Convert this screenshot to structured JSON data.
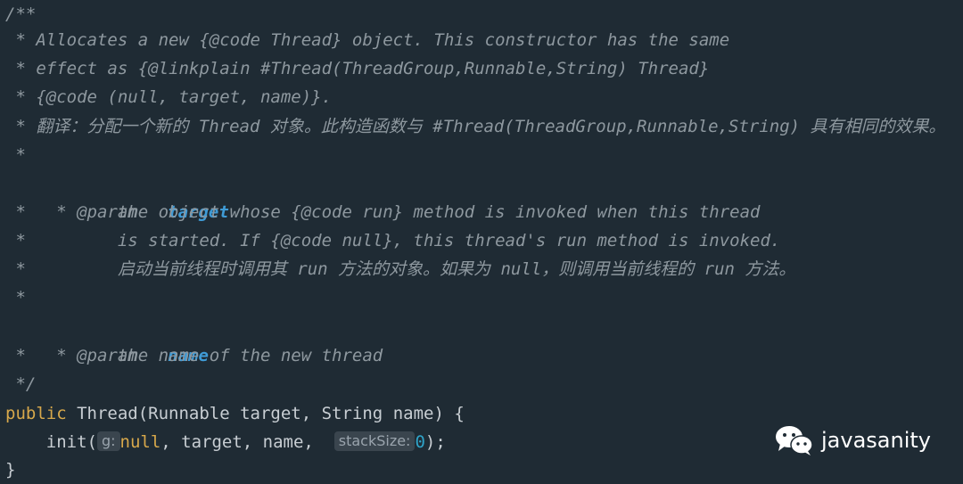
{
  "code_lines": [
    "/**",
    " * Allocates a new {@code Thread} object. This constructor has the same",
    " * effect as {@linkplain #Thread(ThreadGroup,Runnable,String) Thread}",
    " * {@code (null, target, name)}.",
    " * 翻译：分配一个新的 Thread 对象。此构造函数与 #Thread(ThreadGroup,Runnable,String) 具有相同的效果。",
    " *",
    " * @param ",
    " *         the object whose {@code run} method is invoked when this thread",
    " *         is started. If {@code null}, this thread's run method is invoked.",
    " *         启动当前线程时调用其 run 方法的对象。如果为 null，则调用当前线程的 run 方法。",
    " *",
    " * @param ",
    " *         the name of the new thread",
    " */"
  ],
  "params": {
    "target": "target",
    "name": "name"
  },
  "code": {
    "sig_kw": "public",
    "sig_rest": " Thread(Runnable target, String name) {",
    "call_start": "    init(",
    "hint_g": "g:",
    "null_val": "null",
    "call_mid": ", target, name,  ",
    "hint_stack": "stackSize:",
    "zero_val": "0",
    "call_end": ");",
    "close": "}"
  },
  "watermark": {
    "text": "javasanity",
    "icon": "wechat-icon"
  },
  "colors": {
    "background": "#1f2b34",
    "comment": "#8e989f",
    "param": "#3f9bd6",
    "keyword": "#d7a84b"
  }
}
